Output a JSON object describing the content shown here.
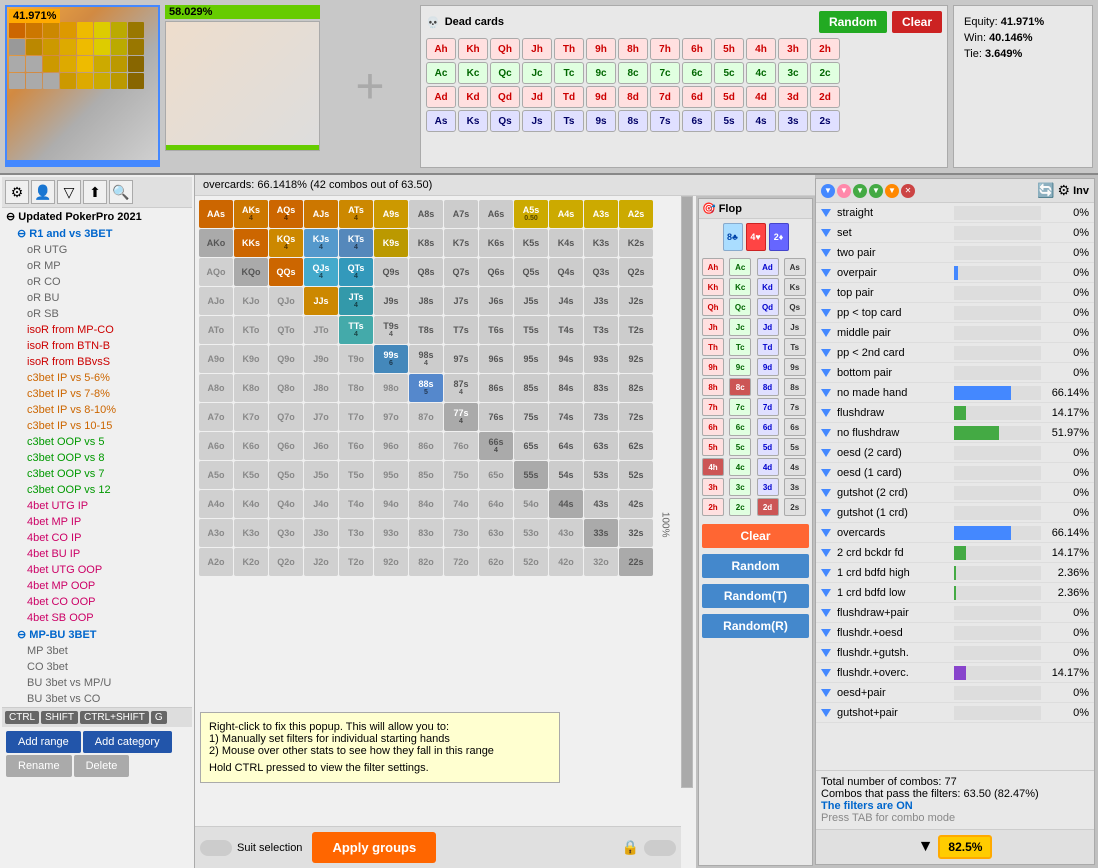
{
  "header": {
    "equity_left": "41.971%",
    "equity_right": "58.029%",
    "dead_cards_title": "Dead cards",
    "btn_random": "Random",
    "btn_clear": "Clear",
    "equity_label": "Equity:",
    "equity_value": "41.971%",
    "win_label": "Win:",
    "win_value": "40.146%",
    "tie_label": "Tie:",
    "tie_value": "3.649%"
  },
  "dead_cards": {
    "rows": [
      [
        "Ah",
        "Kh",
        "Qh",
        "Jh",
        "Th",
        "9h",
        "8h",
        "7h",
        "6h",
        "5h",
        "4h",
        "3h",
        "2h"
      ],
      [
        "Ac",
        "Kc",
        "Qc",
        "Jc",
        "Tc",
        "9c",
        "8c",
        "7c",
        "6c",
        "5c",
        "4c",
        "3c",
        "2c"
      ],
      [
        "Ad",
        "Kd",
        "Qd",
        "Jd",
        "Td",
        "9d",
        "8d",
        "7d",
        "6d",
        "5d",
        "4d",
        "3d",
        "2d"
      ],
      [
        "As",
        "Ks",
        "Qs",
        "Js",
        "Ts",
        "9s",
        "8s",
        "7s",
        "6s",
        "5s",
        "4s",
        "3s",
        "2s"
      ]
    ],
    "suits": [
      "h",
      "c",
      "d",
      "s"
    ]
  },
  "sidebar": {
    "toolbar_icons": [
      "gear",
      "user",
      "filter",
      "export",
      "search"
    ],
    "items": [
      {
        "label": "Updated PokerPro 2021",
        "level": 0,
        "color": "#000000"
      },
      {
        "label": "R1 and vs 3BET",
        "level": 1,
        "color": "#0066cc"
      },
      {
        "label": "oR UTG",
        "level": 2,
        "color": "#666666"
      },
      {
        "label": "oR MP",
        "level": 2,
        "color": "#666666"
      },
      {
        "label": "oR CO",
        "level": 2,
        "color": "#666666"
      },
      {
        "label": "oR BU",
        "level": 2,
        "color": "#666666"
      },
      {
        "label": "oR SB",
        "level": 2,
        "color": "#666666"
      },
      {
        "label": "isoR from MP-CO",
        "level": 2,
        "color": "#cc0000"
      },
      {
        "label": "isoR from BTN-B",
        "level": 2,
        "color": "#cc0000"
      },
      {
        "label": "isoR from BBvsS",
        "level": 2,
        "color": "#cc0000"
      },
      {
        "label": "c3bet IP vs 5-6%",
        "level": 2,
        "color": "#cc6600"
      },
      {
        "label": "c3bet IP vs 7-8%",
        "level": 2,
        "color": "#cc6600"
      },
      {
        "label": "c3bet IP vs 8-10%",
        "level": 2,
        "color": "#cc6600"
      },
      {
        "label": "c3bet IP vs 10-15",
        "level": 2,
        "color": "#cc6600"
      },
      {
        "label": "c3bet OOP vs 5",
        "level": 2,
        "color": "#009900"
      },
      {
        "label": "c3bet OOP vs 8",
        "level": 2,
        "color": "#009900"
      },
      {
        "label": "c3bet OOP vs 7",
        "level": 2,
        "color": "#009900"
      },
      {
        "label": "c3bet OOP vs 12",
        "level": 2,
        "color": "#009900"
      },
      {
        "label": "4bet UTG IP",
        "level": 2,
        "color": "#cc0066"
      },
      {
        "label": "4bet MP IP",
        "level": 2,
        "color": "#cc0066"
      },
      {
        "label": "4bet CO IP",
        "level": 2,
        "color": "#cc0066"
      },
      {
        "label": "4bet BU IP",
        "level": 2,
        "color": "#cc0066"
      },
      {
        "label": "4bet UTG OOP",
        "level": 2,
        "color": "#cc0066"
      },
      {
        "label": "4bet MP OOP",
        "level": 2,
        "color": "#cc0066"
      },
      {
        "label": "4bet CO OOP",
        "level": 2,
        "color": "#cc0066"
      },
      {
        "label": "4bet SB OOP",
        "level": 2,
        "color": "#cc0066"
      },
      {
        "label": "MP-BU 3BET",
        "level": 1,
        "color": "#0066cc"
      },
      {
        "label": "MP 3bet",
        "level": 2,
        "color": "#666666"
      },
      {
        "label": "CO 3bet",
        "level": 2,
        "color": "#666666"
      },
      {
        "label": "BU 3bet vs MP/U",
        "level": 2,
        "color": "#666666"
      },
      {
        "label": "BU 3bet vs CO",
        "level": 2,
        "color": "#666666"
      }
    ],
    "add_range": "Add range",
    "add_category": "Add category",
    "rename": "Rename",
    "delete": "Delete",
    "kb_ctrl": "CTRL",
    "kb_shift": "SHIFT",
    "kb_ctrl_shift": "CTRL+SHIFT",
    "kb_g": "G"
  },
  "center": {
    "header": "overcards: 66.1418%   (42 combos out of 63.50)",
    "scroll_pct": "100%",
    "popup": {
      "line1": "Right-click to fix this popup. This will allow you to:",
      "line2": "1) Manually set filters for individual starting hands",
      "line3": "2) Mouse over other stats to see how they fall in this range",
      "line4": "Hold CTRL pressed to view the filter settings."
    },
    "suit_selection": "Suit selection",
    "apply_groups": "Apply groups"
  },
  "flop": {
    "title": "Flop",
    "cards": [
      "8♣",
      "4♥",
      "2♦"
    ],
    "card_suits": [
      "club",
      "heart",
      "diamond"
    ],
    "btn_clear": "Clear",
    "btn_random": "Random",
    "btn_random_t": "Random(T)",
    "btn_random_r": "Random(R)"
  },
  "stats": {
    "header_label": "Inv",
    "top_pair_label": "top pair",
    "rows": [
      {
        "label": "straight",
        "pct": "0%",
        "bar": 0,
        "bar_color": "bar-blue"
      },
      {
        "label": "set",
        "pct": "0%",
        "bar": 0,
        "bar_color": "bar-blue"
      },
      {
        "label": "two pair",
        "pct": "0%",
        "bar": 0,
        "bar_color": "bar-blue"
      },
      {
        "label": "overpair",
        "pct": "0%",
        "bar": 5,
        "bar_color": "bar-blue"
      },
      {
        "label": "top pair",
        "pct": "0%",
        "bar": 0,
        "bar_color": "bar-blue"
      },
      {
        "label": "pp < top card",
        "pct": "0%",
        "bar": 0,
        "bar_color": "bar-blue"
      },
      {
        "label": "middle pair",
        "pct": "0%",
        "bar": 0,
        "bar_color": "bar-blue"
      },
      {
        "label": "pp < 2nd card",
        "pct": "0%",
        "bar": 0,
        "bar_color": "bar-blue"
      },
      {
        "label": "bottom pair",
        "pct": "0%",
        "bar": 0,
        "bar_color": "bar-blue"
      },
      {
        "label": "no made hand",
        "pct": "66.14%",
        "bar": 66,
        "bar_color": "bar-blue"
      },
      {
        "label": "flushdraw",
        "pct": "14.17%",
        "bar": 14,
        "bar_color": "bar-green"
      },
      {
        "label": "no flushdraw",
        "pct": "51.97%",
        "bar": 52,
        "bar_color": "bar-green"
      },
      {
        "label": "oesd (2 card)",
        "pct": "0%",
        "bar": 0,
        "bar_color": "bar-blue"
      },
      {
        "label": "oesd (1 card)",
        "pct": "0%",
        "bar": 0,
        "bar_color": "bar-blue"
      },
      {
        "label": "gutshot (2 crd)",
        "pct": "0%",
        "bar": 0,
        "bar_color": "bar-blue"
      },
      {
        "label": "gutshot (1 crd)",
        "pct": "0%",
        "bar": 0,
        "bar_color": "bar-blue"
      },
      {
        "label": "overcards",
        "pct": "66.14%",
        "bar": 66,
        "bar_color": "bar-blue"
      },
      {
        "label": "2 crd bckdr fd",
        "pct": "14.17%",
        "bar": 14,
        "bar_color": "bar-green"
      },
      {
        "label": "1 crd bdfd high",
        "pct": "2.36%",
        "bar": 2,
        "bar_color": "bar-green"
      },
      {
        "label": "1 crd bdfd low",
        "pct": "2.36%",
        "bar": 2,
        "bar_color": "bar-green"
      },
      {
        "label": "flushdraw+pair",
        "pct": "0%",
        "bar": 0,
        "bar_color": "bar-blue"
      },
      {
        "label": "flushdr.+oesd",
        "pct": "0%",
        "bar": 0,
        "bar_color": "bar-blue"
      },
      {
        "label": "flushdr.+gutsh.",
        "pct": "0%",
        "bar": 0,
        "bar_color": "bar-blue"
      },
      {
        "label": "flushdr.+overc.",
        "pct": "14.17%",
        "bar": 14,
        "bar_color": "bar-purple"
      },
      {
        "label": "oesd+pair",
        "pct": "0%",
        "bar": 0,
        "bar_color": "bar-blue"
      },
      {
        "label": "gutshot+pair",
        "pct": "0%",
        "bar": 0,
        "bar_color": "bar-blue"
      }
    ],
    "total_combos": "Total number of combos: 77",
    "combos_pass": "Combos that pass the filters: 63.50 (82.47%)",
    "filters_on": "The filters are ON",
    "tab_mode": "Press TAB for combo mode",
    "filter_pct": "82.5%"
  },
  "matrix_cells": [
    [
      "AAs",
      "AKs",
      "AQs",
      "AJs",
      "ATs",
      "A9s",
      "A8s",
      "A7s",
      "A6s",
      "A5s",
      "A4s",
      "A3s",
      "A2s"
    ],
    [
      "AKo",
      "KKs",
      "KQs",
      "KJs",
      "KTs",
      "K9s",
      "K8s",
      "K7s",
      "K6s",
      "K5s",
      "K4s",
      "K3s",
      "K2s"
    ],
    [
      "AQo",
      "KQo",
      "QQs",
      "QJs",
      "QTs",
      "Q9s",
      "Q8s",
      "Q7s",
      "Q6s",
      "Q5s",
      "Q4s",
      "Q3s",
      "Q2s"
    ],
    [
      "AJo",
      "KJo",
      "QJo",
      "JJs",
      "JTs",
      "J9s",
      "J8s",
      "J7s",
      "J6s",
      "J5s",
      "J4s",
      "J3s",
      "J2s"
    ],
    [
      "ATo",
      "KTo",
      "QTo",
      "JTo",
      "TTs",
      "T9s",
      "T8s",
      "T7s",
      "T6s",
      "T5s",
      "T4s",
      "T3s",
      "T2s"
    ],
    [
      "A9o",
      "K9o",
      "Q9o",
      "J9o",
      "T9o",
      "99s",
      "98s",
      "97s",
      "96s",
      "95s",
      "94s",
      "93s",
      "92s"
    ],
    [
      "A8o",
      "K8o",
      "Q8o",
      "J8o",
      "T8o",
      "98o",
      "88s",
      "87s",
      "86s",
      "85s",
      "84s",
      "83s",
      "82s"
    ],
    [
      "A7o",
      "K7o",
      "Q7o",
      "J7o",
      "T7o",
      "97o",
      "87o",
      "77s",
      "76s",
      "75s",
      "74s",
      "73s",
      "72s"
    ],
    [
      "A6o",
      "K6o",
      "Q6o",
      "J6o",
      "T6o",
      "96o",
      "86o",
      "76o",
      "66s",
      "65s",
      "64s",
      "63s",
      "62s"
    ],
    [
      "A5o",
      "K5o",
      "Q5o",
      "J5o",
      "T5o",
      "95o",
      "85o",
      "75o",
      "65o",
      "55s",
      "54s",
      "53s",
      "52s"
    ],
    [
      "A4o",
      "K4o",
      "Q4o",
      "J4o",
      "T4o",
      "94o",
      "84o",
      "74o",
      "64o",
      "54o",
      "44s",
      "43s",
      "42s"
    ],
    [
      "A3o",
      "K3o",
      "Q3o",
      "J3o",
      "T3o",
      "93o",
      "83o",
      "73o",
      "63o",
      "53o",
      "43o",
      "33s",
      "32s"
    ],
    [
      "A2o",
      "K2o",
      "Q2o",
      "J2o",
      "T2o",
      "92o",
      "82o",
      "72o",
      "62o",
      "52o",
      "42o",
      "32o",
      "22s"
    ]
  ]
}
